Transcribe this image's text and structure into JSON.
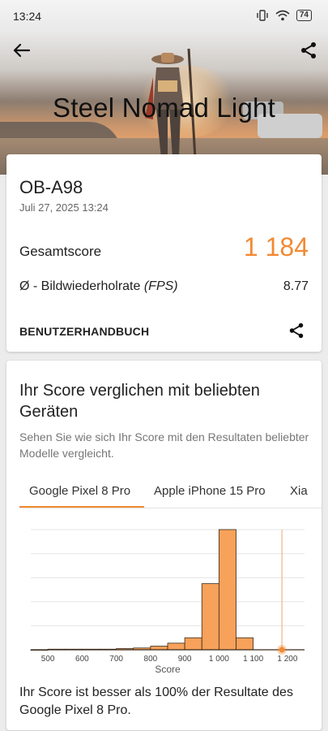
{
  "status_bar": {
    "time": "13:24",
    "battery": "74"
  },
  "header": {
    "title": "Steel Nomad Light"
  },
  "result": {
    "device": "OB-A98",
    "date": "Juli 27, 2025 13:24",
    "score_label": "Gesamtscore",
    "score_value": "1 184",
    "fps_label_prefix": "Ø - Bildwiederholrate ",
    "fps_label_unit": "(FPS)",
    "fps_value": "8.77",
    "manual_label": "BENUTZERHANDBUCH"
  },
  "comparison": {
    "title": "Ihr Score verglichen mit beliebten Geräten",
    "subtitle": "Sehen Sie wie sich Ihr Score mit den Resultaten beliebter Modelle vergleicht.",
    "tabs": [
      "Google Pixel 8 Pro",
      "Apple iPhone 15 Pro",
      "Xia"
    ],
    "active_tab": 0,
    "result_text": "Ihr Score ist besser als 100% der Resultate des Google Pixel 8 Pro."
  },
  "colors": {
    "accent": "#f28a33",
    "bar_fill": "#f7a15a",
    "bar_stroke": "#3a2a1a"
  },
  "chart_data": {
    "type": "bar",
    "xlabel": "Score",
    "ylabel": "",
    "xlim": [
      450,
      1250
    ],
    "ylim": [
      0,
      1.0
    ],
    "tick_labels": [
      "500",
      "600",
      "700",
      "800",
      "900",
      "1 000",
      "1 100",
      "1 200"
    ],
    "tick_values": [
      500,
      600,
      700,
      800,
      900,
      1000,
      1100,
      1200
    ],
    "bin_edges": [
      450,
      500,
      550,
      600,
      650,
      700,
      750,
      800,
      850,
      900,
      950,
      1000,
      1050,
      1100
    ],
    "values": [
      0.0,
      0.005,
      0.005,
      0.005,
      0.005,
      0.01,
      0.015,
      0.03,
      0.055,
      0.1,
      0.55,
      1.0,
      0.1
    ],
    "marker_score": 1184,
    "grid": true
  }
}
